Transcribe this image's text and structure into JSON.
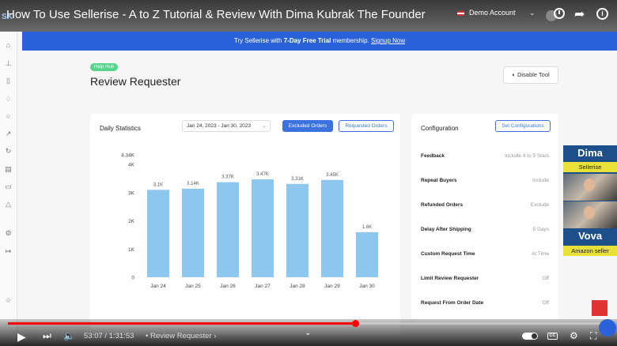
{
  "youtube": {
    "video_title": "How To Use Sellerise - A to Z Tutorial & Review With Dima Kubrak The Founder",
    "account_name": "Demo Account",
    "current_time": "53:07",
    "duration": "1:31:53",
    "chapter": "• Review Requester ›",
    "progress_fraction": 0.578,
    "buffered_fraction": 0.58
  },
  "banner": {
    "prefix": "Try Sellerise with ",
    "highlight": "7-Day Free Trial",
    "suffix": " membership. ",
    "link": "Signup Now"
  },
  "page": {
    "badge": "Help Hub",
    "title": "Review Requester",
    "disable_button": "Disable Tool"
  },
  "stats": {
    "title": "Daily Statistics",
    "date_range": "Jan 24, 2023 - Jan 30, 2023",
    "excluded_orders": "Excluded Orders",
    "requested_orders": "Requested Orders"
  },
  "chart_data": {
    "type": "bar",
    "categories": [
      "Jan 24",
      "Jan 25",
      "Jan 26",
      "Jan 27",
      "Jan 28",
      "Jan 29",
      "Jan 30"
    ],
    "values": [
      3100,
      3140,
      3370,
      3470,
      3310,
      3450,
      1600
    ],
    "data_labels": [
      "3.1K",
      "3.14K",
      "3.37K",
      "3.47K",
      "3.31K",
      "3.45K",
      "1.6K"
    ],
    "y_ticks": [
      "0",
      "1K",
      "2K",
      "3K",
      "4K",
      "4.34K"
    ],
    "y_tick_values": [
      0,
      1000,
      2000,
      3000,
      4000,
      4340
    ],
    "ylim": [
      0,
      4340
    ],
    "bar_color": "#8ec7ee"
  },
  "config": {
    "title": "Configuration",
    "set_button": "Set Configurations",
    "rows": [
      {
        "label": "Feedback",
        "value": "Include 4 to 5 Stars"
      },
      {
        "label": "Repeat Buyers",
        "value": "Include"
      },
      {
        "label": "Refunded Orders",
        "value": "Exclude"
      },
      {
        "label": "Delay After Shipping",
        "value": "5 Days"
      },
      {
        "label": "Custom Request Time",
        "value": "At Time"
      },
      {
        "label": "Limit Review Requester",
        "value": "Off"
      },
      {
        "label": "Request From Order Date",
        "value": "Off"
      }
    ]
  },
  "webcam": {
    "name1": "Dima",
    "tag1": "Sellerise",
    "name2": "Vova",
    "tag2": "Amazon seller"
  }
}
